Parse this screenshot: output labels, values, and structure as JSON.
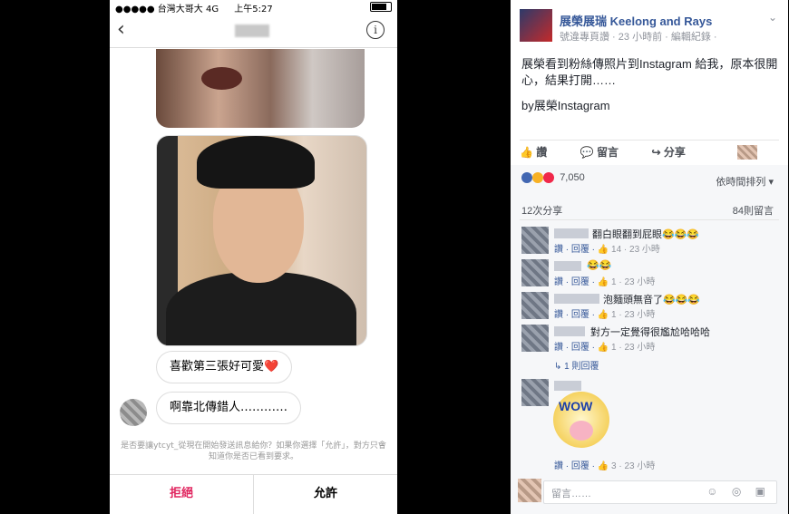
{
  "phone": {
    "carrier": "●●●●● 台灣大哥大  4G",
    "time": "上午5:27",
    "back_glyph": "‹",
    "info_glyph": "i",
    "bubble1": "喜歡第三張好可愛❤️",
    "bubble2": "啊靠北傳錯人…………",
    "notice": "是否要讓ytcyt_從現在開始發送訊息給你？如果你選擇「允許」，對方只會知道你是否已看到要求。",
    "deny": "拒絕",
    "allow": "允許"
  },
  "facebook": {
    "page_name": "展榮展瑞 Keelong and Rays",
    "meta": "號違專頁讚 · 23 小時前 · 編輯紀錄 · ",
    "post_text": "展榮看到粉絲傳照片到Instagram 給我，原本很開心，結果打開……",
    "post_by": "by展榮Instagram",
    "like": "讚",
    "comment": "留言",
    "share": "分享",
    "reaction_count": "7,050",
    "sort": "依時間排列 ▾",
    "shares": "12次分享",
    "comments_count": "84則留言",
    "comments": [
      {
        "text": "翻白眼翻到屁眼😂😂😂",
        "likes": "14",
        "time": "23 小時"
      },
      {
        "text": "😂😂",
        "likes": "1",
        "time": "23 小時"
      },
      {
        "text": "泡麵頭無音了😂😂😂",
        "likes": "1",
        "time": "23 小時"
      },
      {
        "text": "對方一定覺得很尷尬哈哈哈",
        "likes": "1",
        "time": "23 小時"
      },
      {
        "text": "",
        "likes": "3",
        "time": "23 小時"
      }
    ],
    "reply_label": "讚 · 回覆 ·",
    "replies": "↳ 1 則回覆",
    "sticker_text": "WOW",
    "comment_placeholder": "留言……",
    "comment_icons": "☺ ◎ ▣"
  }
}
